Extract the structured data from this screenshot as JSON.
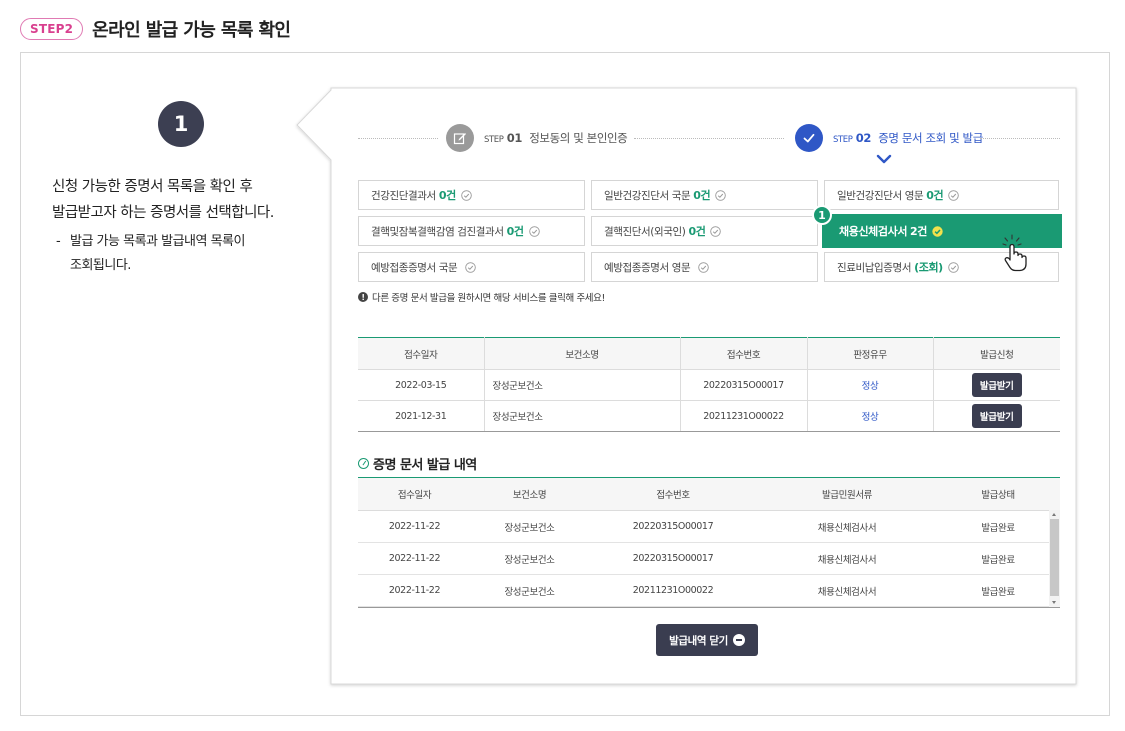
{
  "header": {
    "step_badge": "STEP2",
    "title": "온라인 발급 가능 목록 확인"
  },
  "guide": {
    "number": "1",
    "line1": "신청 가능한 증명서 목록을 확인 후",
    "line2": "발급받고자 하는 증명서를 선택합니다.",
    "note_dash": "-",
    "note_line1": "발급 가능 목록과 발급내역 목록이",
    "note_line2": "조회됩니다."
  },
  "progress": {
    "step1": {
      "small": "STEP",
      "num": "01",
      "label": "정보동의 및 본인인증",
      "icon": "edit-icon"
    },
    "step2": {
      "small": "STEP",
      "num": "02",
      "label": "증명 문서 조회 및 발급",
      "icon": "check-icon"
    }
  },
  "certs": [
    {
      "name": "건강진단결과서",
      "count": "0건"
    },
    {
      "name": "일반건강진단서 국문",
      "count": "0건"
    },
    {
      "name": "일반건강진단서 영문",
      "count": "0건"
    },
    {
      "name": "결핵및잠복결핵감염 검진결과서",
      "count": "0건"
    },
    {
      "name": "결핵진단서(외국인)",
      "count": "0건"
    },
    {
      "name": "채용신체검사서",
      "count": "2건"
    },
    {
      "name": "예방접종증명서 국문",
      "count": ""
    },
    {
      "name": "예방접종증명서 영문",
      "count": ""
    },
    {
      "name": "진료비납입증명서",
      "count": "(조회)"
    }
  ],
  "selected_badge": "1",
  "notice": "다른 증명 문서 발급을 원하시면 해당 서비스를 클릭해 주세요!",
  "issue_table": {
    "headers": [
      "접수일자",
      "보건소명",
      "접수번호",
      "판정유무",
      "발급신청"
    ],
    "rows": [
      {
        "date": "2022-03-15",
        "center": "장성군보건소",
        "receipt": "20220315O00017",
        "judge": "정상",
        "action": "발급받기"
      },
      {
        "date": "2021-12-31",
        "center": "장성군보건소",
        "receipt": "20211231O00022",
        "judge": "정상",
        "action": "발급받기"
      }
    ]
  },
  "history": {
    "title": "증명 문서 발급 내역",
    "headers": [
      "접수일자",
      "보건소명",
      "접수번호",
      "발급민원서류",
      "발급상태"
    ],
    "rows": [
      {
        "date": "2022-11-22",
        "center": "장성군보건소",
        "receipt": "20220315O00017",
        "doc": "채용신체검사서",
        "status": "발급완료"
      },
      {
        "date": "2022-11-22",
        "center": "장성군보건소",
        "receipt": "20220315O00017",
        "doc": "채용신체검사서",
        "status": "발급완료"
      },
      {
        "date": "2022-11-22",
        "center": "장성군보건소",
        "receipt": "20211231O00022",
        "doc": "채용신체검사서",
        "status": "발급완료"
      }
    ],
    "close_label": "발급내역 닫기"
  },
  "colors": {
    "accent_green": "#1a9a73",
    "brand_pink": "#d9408f",
    "active_blue": "#2f57c6",
    "dark_button": "#3a3d50"
  }
}
